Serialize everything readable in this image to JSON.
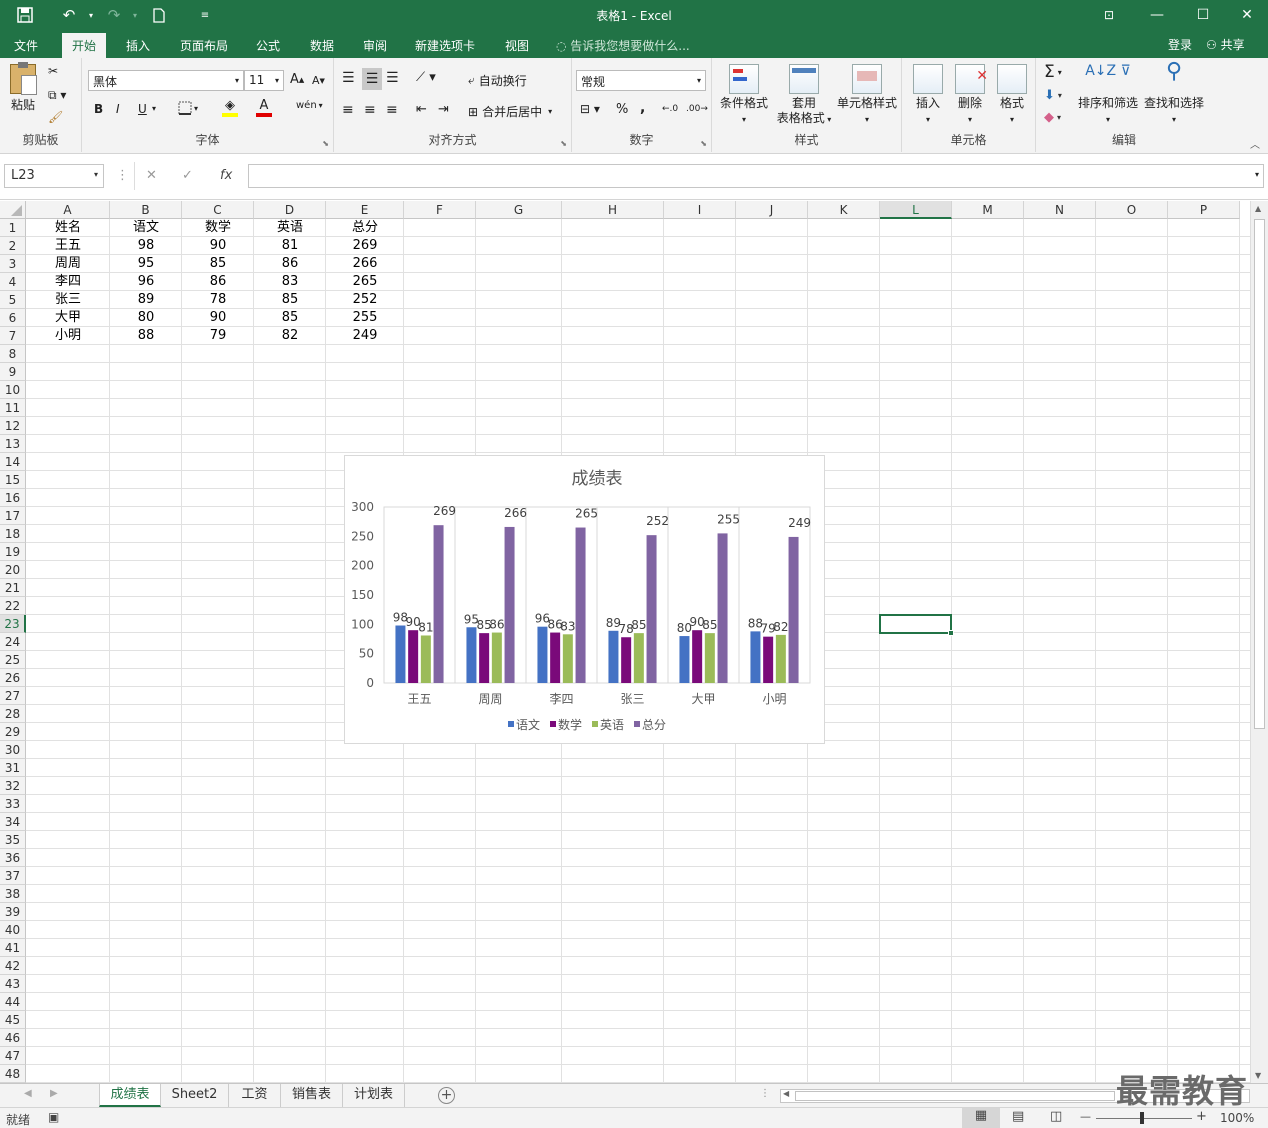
{
  "window": {
    "title": "表格1 - Excel",
    "minimize": "—",
    "maximize": "☐",
    "close": "✕",
    "ribbon_display": "⊡"
  },
  "menu_tabs": [
    {
      "label": "文件"
    },
    {
      "label": "开始"
    },
    {
      "label": "插入"
    },
    {
      "label": "页面布局"
    },
    {
      "label": "公式"
    },
    {
      "label": "数据"
    },
    {
      "label": "审阅"
    },
    {
      "label": "新建选项卡"
    },
    {
      "label": "视图"
    }
  ],
  "tell_me": "告诉我您想要做什么...",
  "login": "登录",
  "share": "共享",
  "ribbon": {
    "clipboard": {
      "paste": "粘贴",
      "group": "剪贴板"
    },
    "font": {
      "name": "黑体",
      "size": "11",
      "group": "字体",
      "bold": "B",
      "italic": "I",
      "underline": "U",
      "grow": "A",
      "shrink": "A",
      "font_color": "A",
      "phonetic": "wén"
    },
    "alignment": {
      "wrap": "自动换行",
      "merge": "合并后居中",
      "group": "对齐方式"
    },
    "number": {
      "format": "常规",
      "percent": "%",
      "comma": ",",
      "group": "数字"
    },
    "styles": {
      "conditional": "条件格式",
      "table_l1": "套用",
      "table_l2": "表格格式",
      "cell_styles": "单元格样式",
      "group": "样式"
    },
    "cells": {
      "insert": "插入",
      "delete": "删除",
      "format": "格式",
      "group": "单元格"
    },
    "editing": {
      "sort": "排序和筛选",
      "find": "查找和选择",
      "group": "编辑",
      "sum": "Σ"
    }
  },
  "formula_bar": {
    "name_box": "L23",
    "fx": "fx",
    "formula": ""
  },
  "columns": [
    "A",
    "B",
    "C",
    "D",
    "E",
    "F",
    "G",
    "H",
    "I",
    "J",
    "K",
    "L",
    "M",
    "N",
    "O",
    "P"
  ],
  "selected_column": "L",
  "selected_row": 23,
  "rows": [
    "1",
    "2",
    "3",
    "4",
    "5",
    "6",
    "7",
    "8",
    "9",
    "10",
    "11",
    "12",
    "13",
    "14",
    "15",
    "16",
    "17",
    "18",
    "19",
    "20",
    "21",
    "22",
    "23",
    "24",
    "25",
    "26",
    "27",
    "28",
    "29",
    "30",
    "31",
    "32",
    "33",
    "34",
    "35",
    "36",
    "37",
    "38",
    "39",
    "40",
    "41",
    "42",
    "43",
    "44",
    "45",
    "46",
    "47",
    "48"
  ],
  "table": {
    "header": [
      "姓名",
      "语文",
      "数学",
      "英语",
      "总分"
    ],
    "rows": [
      [
        "王五",
        "98",
        "90",
        "81",
        "269"
      ],
      [
        "周周",
        "95",
        "85",
        "86",
        "266"
      ],
      [
        "李四",
        "96",
        "86",
        "83",
        "265"
      ],
      [
        "张三",
        "89",
        "78",
        "85",
        "252"
      ],
      [
        "大甲",
        "80",
        "90",
        "85",
        "255"
      ],
      [
        "小明",
        "88",
        "79",
        "82",
        "249"
      ]
    ]
  },
  "chart_data": {
    "type": "bar",
    "title": "成绩表",
    "categories": [
      "王五",
      "周周",
      "李四",
      "张三",
      "大甲",
      "小明"
    ],
    "series": [
      {
        "name": "语文",
        "color": "#4472c4",
        "values": [
          98,
          95,
          96,
          89,
          80,
          88
        ]
      },
      {
        "name": "数学",
        "color": "#7a0a7a",
        "values": [
          90,
          85,
          86,
          78,
          90,
          79
        ]
      },
      {
        "name": "英语",
        "color": "#9bbb59",
        "values": [
          81,
          86,
          83,
          85,
          85,
          82
        ]
      },
      {
        "name": "总分",
        "color": "#8064a2",
        "values": [
          269,
          266,
          265,
          252,
          255,
          249
        ]
      }
    ],
    "ylim": [
      0,
      300
    ],
    "yticks": [
      0,
      50,
      100,
      150,
      200,
      250,
      300
    ],
    "grid": true,
    "legend": "bottom",
    "data_labels": true
  },
  "sheets": [
    {
      "label": "成绩表",
      "active": true
    },
    {
      "label": "Sheet2"
    },
    {
      "label": "工资"
    },
    {
      "label": "销售表"
    },
    {
      "label": "计划表"
    }
  ],
  "add_sheet": "+",
  "status": {
    "ready": "就绪",
    "zoom": "100%",
    "zoom_minus": "—",
    "zoom_plus": "+"
  },
  "watermark": "最需教育"
}
